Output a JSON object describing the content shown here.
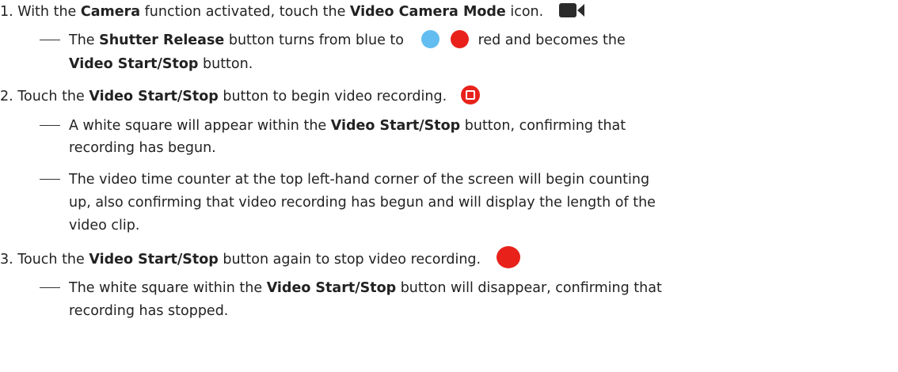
{
  "steps": [
    {
      "number": "1.",
      "parts": [
        "With the ",
        "Camera",
        " function activated, touch the ",
        "Video Camera Mode",
        " icon."
      ],
      "icon": "video-camera-mode-icon",
      "notes": [
        {
          "lines": [
            [
              "The ",
              "Shutter Release",
              " button turns from blue to ",
              "red and becomes the"
            ],
            [
              "Video Start/Stop",
              " button."
            ]
          ],
          "icons": [
            "blue-circle-icon",
            "red-circle-icon"
          ]
        }
      ]
    },
    {
      "number": "2.",
      "parts": [
        "Touch the ",
        "Video Start/Stop",
        " button to begin video recording."
      ],
      "icon": "video-stop-button-icon",
      "notes": [
        {
          "lines": [
            [
              "A white square will appear within the ",
              "Video Start/Stop",
              " button, confirming that"
            ],
            [
              "recording has begun."
            ]
          ]
        },
        {
          "lines": [
            [
              "The video time counter at the top left-hand corner of the screen will begin counting"
            ],
            [
              "up, also confirming that video recording has begun and will display the length of the"
            ],
            [
              "video clip."
            ]
          ]
        }
      ]
    },
    {
      "number": "3.",
      "parts": [
        "Touch the ",
        "Video Start/Stop",
        " button again to stop video recording."
      ],
      "icon": "video-record-button-icon",
      "notes": [
        {
          "lines": [
            [
              "The white square within the ",
              "Video Start/Stop",
              " button will disappear, confirming that"
            ],
            [
              "recording has stopped."
            ]
          ]
        }
      ]
    }
  ],
  "colors": {
    "blue_button": "#63bdf0",
    "red_button": "#e8221b",
    "camera_icon": "#2b2b2b"
  }
}
